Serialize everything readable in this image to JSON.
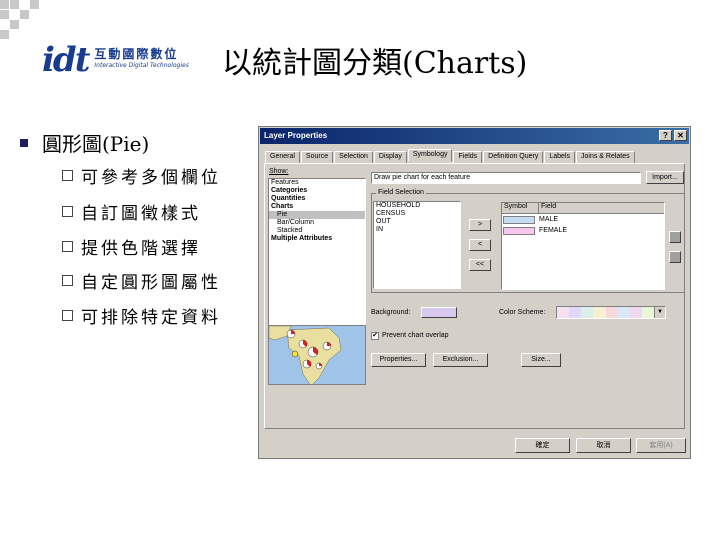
{
  "logo": {
    "cn": "互動國際數位",
    "en": "Interactive Digital Technologies"
  },
  "title": "以統計圖分類(Charts)",
  "main_bullet": "圓形圖(Pie)",
  "sub_bullets": [
    "可參考多個欄位",
    "自訂圖徵樣式",
    "提供色階選擇",
    "自定圓形圖屬性",
    "可排除特定資料"
  ],
  "dialog": {
    "title": "Layer Properties",
    "help": "?",
    "close": "✕",
    "tabs": [
      "General",
      "Source",
      "Selection",
      "Display",
      "Symbology",
      "Fields",
      "Definition Query",
      "Labels",
      "Joins & Relates"
    ],
    "show_label": "Show:",
    "show_items": [
      "Features",
      "Categories",
      "Quantities",
      "Charts",
      "Pie",
      "Bar/Column",
      "Stacked",
      "Multiple Attributes"
    ],
    "description": "Draw pie chart for each feature",
    "import_button": "Import...",
    "field_selection_label": "Field Selection",
    "fields": [
      "HOUSEHOLD",
      "CENSUS",
      "OUT",
      "IN"
    ],
    "move_right": ">",
    "move_left": "<",
    "move_all_left": "<<",
    "symbol_header": "Symbol",
    "field_header": "Field",
    "symbol_rows": [
      {
        "field": "MALE",
        "color": "#c6dcf2"
      },
      {
        "field": "FEMALE",
        "color": "#f6c6ec"
      }
    ],
    "background_label": "Background:",
    "background_color": "#d8c8ee",
    "color_scheme_label": "Color Scheme:",
    "prevent_overlap_label": "Prevent chart overlap",
    "properties_button": "Properties...",
    "exclusion_button": "Exclusion...",
    "size_button": "Size...",
    "ok_button": "確定",
    "cancel_button": "取消",
    "apply_button": "套用(A)"
  }
}
